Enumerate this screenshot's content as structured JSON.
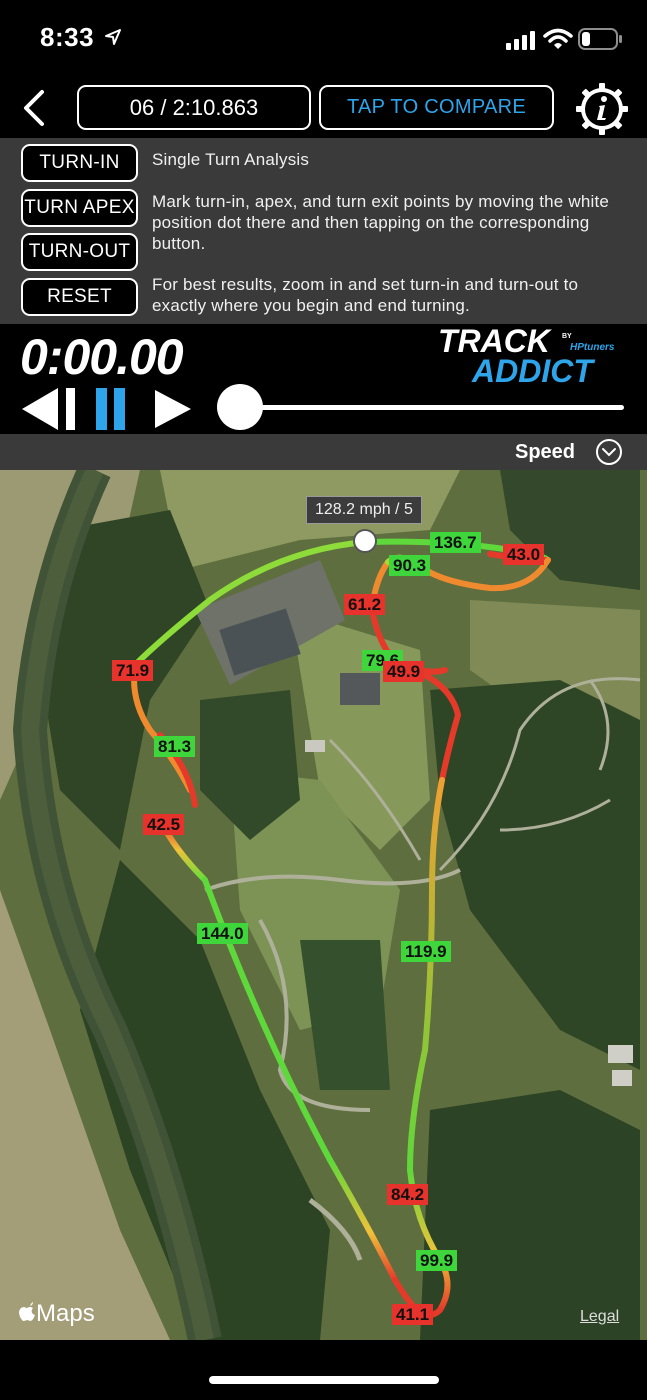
{
  "status_bar": {
    "time": "8:33",
    "icons": [
      "location-arrow-icon",
      "signal-icon",
      "wifi-icon",
      "battery-icon"
    ]
  },
  "header": {
    "lap_display": "06 / 2:10.863",
    "compare_label": "TAP TO COMPARE",
    "compare_color": "#2ea4ea",
    "icons": [
      "back-chevron-icon",
      "info-gear-icon"
    ]
  },
  "analysis": {
    "buttons": [
      "TURN-IN",
      "TURN APEX",
      "TURN-OUT",
      "RESET"
    ],
    "title": "Single Turn Analysis",
    "instructions": "Mark turn-in, apex, and turn exit points by moving the white position dot there and then tapping on the corresponding button.",
    "tip": "For best results, zoom in and set turn-in and turn-out to exactly where you begin and end turning."
  },
  "playback": {
    "timer": "0:00.00",
    "logo_text_1": "TRACK",
    "logo_text_2": "ADDICT",
    "logo_by": "BY",
    "logo_brand": "HPtuners",
    "pause_color": "#2ea4ea",
    "scrub_position": 0.0,
    "icons": [
      "rewind-icon",
      "pause-icon",
      "play-icon"
    ]
  },
  "overlay": {
    "mode_label": "Speed",
    "icons": [
      "chevron-down-circle-icon"
    ]
  },
  "map": {
    "tooltip": "128.2 mph / 5",
    "speed_labels": [
      "136.7",
      "43.0",
      "90.3",
      "61.2",
      "79.6",
      "49.9",
      "71.9",
      "81.3",
      "42.5",
      "144.0",
      "119.9",
      "84.2",
      "99.9",
      "41.1"
    ],
    "fast_color": "#3ed63b",
    "slow_color": "#e8322c",
    "attribution": "Maps",
    "legal": "Legal"
  }
}
